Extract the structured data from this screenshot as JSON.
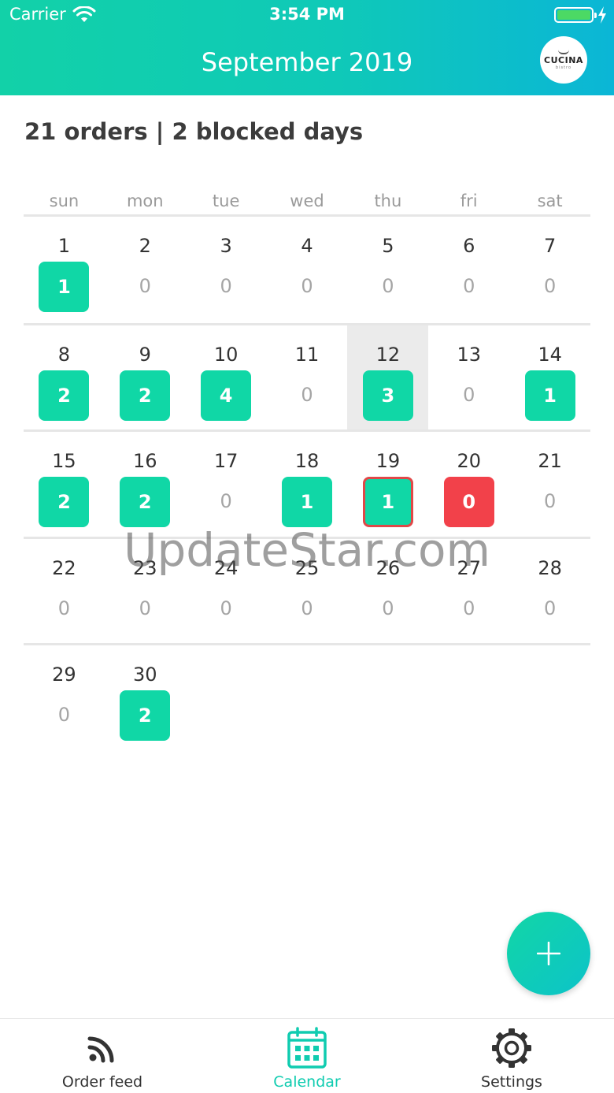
{
  "status_bar": {
    "carrier": "Carrier",
    "time": "3:54 PM"
  },
  "header": {
    "title": "September 2019",
    "logo_text": "CUCINA",
    "logo_subtext": "bistro"
  },
  "summary": "21 orders | 2 blocked days",
  "calendar": {
    "weekdays": [
      "sun",
      "mon",
      "tue",
      "wed",
      "thu",
      "fri",
      "sat"
    ],
    "weeks": [
      [
        {
          "day": "1",
          "count": "1",
          "state": "orders"
        },
        {
          "day": "2",
          "count": "0",
          "state": "empty"
        },
        {
          "day": "3",
          "count": "0",
          "state": "empty"
        },
        {
          "day": "4",
          "count": "0",
          "state": "empty"
        },
        {
          "day": "5",
          "count": "0",
          "state": "empty"
        },
        {
          "day": "6",
          "count": "0",
          "state": "empty"
        },
        {
          "day": "7",
          "count": "0",
          "state": "empty"
        }
      ],
      [
        {
          "day": "8",
          "count": "2",
          "state": "orders"
        },
        {
          "day": "9",
          "count": "2",
          "state": "orders"
        },
        {
          "day": "10",
          "count": "4",
          "state": "orders"
        },
        {
          "day": "11",
          "count": "0",
          "state": "empty"
        },
        {
          "day": "12",
          "count": "3",
          "state": "orders",
          "today": true
        },
        {
          "day": "13",
          "count": "0",
          "state": "empty"
        },
        {
          "day": "14",
          "count": "1",
          "state": "orders"
        }
      ],
      [
        {
          "day": "15",
          "count": "2",
          "state": "orders"
        },
        {
          "day": "16",
          "count": "2",
          "state": "orders"
        },
        {
          "day": "17",
          "count": "0",
          "state": "empty"
        },
        {
          "day": "18",
          "count": "1",
          "state": "orders"
        },
        {
          "day": "19",
          "count": "1",
          "state": "orders-blocked"
        },
        {
          "day": "20",
          "count": "0",
          "state": "blocked"
        },
        {
          "day": "21",
          "count": "0",
          "state": "empty"
        }
      ],
      [
        {
          "day": "22",
          "count": "0",
          "state": "empty"
        },
        {
          "day": "23",
          "count": "0",
          "state": "empty"
        },
        {
          "day": "24",
          "count": "0",
          "state": "empty"
        },
        {
          "day": "25",
          "count": "0",
          "state": "empty"
        },
        {
          "day": "26",
          "count": "0",
          "state": "empty"
        },
        {
          "day": "27",
          "count": "0",
          "state": "empty"
        },
        {
          "day": "28",
          "count": "0",
          "state": "empty"
        }
      ],
      [
        {
          "day": "29",
          "count": "0",
          "state": "empty"
        },
        {
          "day": "30",
          "count": "2",
          "state": "orders"
        },
        null,
        null,
        null,
        null,
        null
      ]
    ]
  },
  "watermark": "UpdateStar.com",
  "fab": {
    "icon": "plus-icon"
  },
  "tabbar": {
    "tabs": [
      {
        "label": "Order feed",
        "icon": "rss-icon",
        "active": false
      },
      {
        "label": "Calendar",
        "icon": "calendar-icon",
        "active": true
      },
      {
        "label": "Settings",
        "icon": "gear-icon",
        "active": false
      }
    ]
  },
  "colors": {
    "accent": "#10d7a6",
    "blocked": "#f2414a",
    "blocked_outline": "#e04848",
    "today_bg": "#ebebeb",
    "header_gradient_start": "#12d1a8",
    "header_gradient_end": "#0bb6d6"
  }
}
